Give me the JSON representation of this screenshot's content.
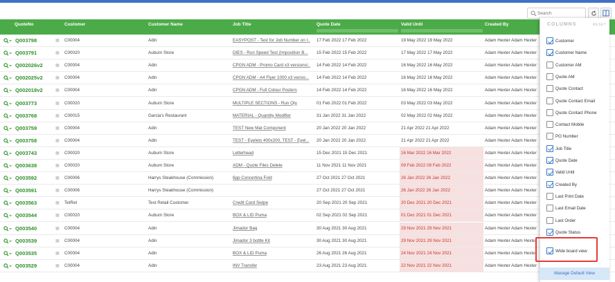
{
  "toolbar": {
    "search_placeholder": "Search"
  },
  "columns": [
    "QuoteNo",
    "Customer",
    "Customer Name",
    "Job Title",
    "Quote Date",
    "Valid Until",
    "Created By"
  ],
  "rows": [
    {
      "quote": "Q003798",
      "customer": "C00004",
      "customer_name": "Adin",
      "job_title": "EASYPOST - Test for Job Number on I...",
      "quote_date": "17 Feb 2022 17 Feb 2022",
      "valid_until": "19 May 2022 19 May 2022",
      "created_by": "Adam Hexter Adam Hexter",
      "expired": false
    },
    {
      "quote": "Q003791",
      "customer": "C00020",
      "customer_name": "Auburn Store",
      "job_title": "DIES - Run Speed Test (Imposition B...",
      "quote_date": "15 Feb 2022 15 Feb 2022",
      "valid_until": "17 May 2022 17 May 2022",
      "created_by": "Adam Hexter Adam Hexter",
      "expired": false
    },
    {
      "quote": "Q002026v2",
      "customer": "C00004",
      "customer_name": "Adin",
      "job_title": "CPGN ADM - Promo Card x3 versions/...",
      "quote_date": "14 Feb 2022 14 Feb 2022",
      "valid_until": "16 May 2022 16 May 2022",
      "created_by": "Adam Hexter Adam Hexter",
      "expired": false
    },
    {
      "quote": "Q002025v2",
      "customer": "C00004",
      "customer_name": "Adin",
      "job_title": "CPGN ADM - A4 Flyer 1000 x3 versio...",
      "quote_date": "14 Feb 2022 14 Feb 2022",
      "valid_until": "16 May 2022 16 May 2022",
      "created_by": "Adam Hexter Adam Hexter",
      "expired": false
    },
    {
      "quote": "Q002018v2",
      "customer": "C00004",
      "customer_name": "Adin",
      "job_title": "CPGN ADM - Full Colour Posters",
      "quote_date": "14 Feb 2022 14 Feb 2022",
      "valid_until": "16 May 2022 16 May 2022",
      "created_by": "Adam Hexter Adam Hexter",
      "expired": false
    },
    {
      "quote": "Q003773",
      "customer": "C00020",
      "customer_name": "Auburn Store",
      "job_title": "MULTIPLE SECTIONS - Run Qty",
      "quote_date": "01 Feb 2022 01 Feb 2022",
      "valid_until": "03 May 2022 03 May 2022",
      "created_by": "Adam Hexter Adam Hexter",
      "expired": false
    },
    {
      "quote": "Q003768",
      "customer": "C00015",
      "customer_name": "Garcia's Restaurant",
      "job_title": "MATERIAL - Quantity Modifier",
      "quote_date": "31 Jan 2022 31 Jan 2022",
      "valid_until": "02 May 2022 02 May 2022",
      "created_by": "Adam Hexter Adam Hexter",
      "expired": false
    },
    {
      "quote": "Q003759",
      "customer": "C00004",
      "customer_name": "Adin",
      "job_title": "TEST New Mat Component",
      "quote_date": "20 Jan 2022 20 Jan 2022",
      "valid_until": "21 Apr 2022 21 Apr 2022",
      "created_by": "Adam Hexter Adam Hexter",
      "expired": false
    },
    {
      "quote": "Q003758",
      "customer": "C00004",
      "customer_name": "Adin",
      "job_title": "TEST - Eyelets 400x200, TEST - Eyel...",
      "quote_date": "20 Jan 2022 20 Jan 2022",
      "valid_until": "21 Apr 2022 21 Apr 2022",
      "created_by": "Adam Hexter Adam Hexter",
      "expired": false
    },
    {
      "quote": "Q003743",
      "customer": "C00020",
      "customer_name": "Auburn Store",
      "job_title": "Letterhead",
      "quote_date": "15 Dec 2021 15 Dec 2021",
      "valid_until": "16 Mar 2022 16 Mar 2022",
      "created_by": "Adam Hexter Adam Hexter",
      "expired": true
    },
    {
      "quote": "Q003638",
      "customer": "C00020",
      "customer_name": "Auburn Store",
      "job_title": "ADM - Quote Files Delete",
      "quote_date": "11 Nov 2021 11 Nov 2021",
      "valid_until": "09 Feb 2022 09 Feb 2022",
      "created_by": "Adam Hexter Adam Hexter",
      "expired": true
    },
    {
      "quote": "Q003592",
      "customer": "C00006",
      "customer_name": "Harrys Steakhouse (Commission)",
      "job_title": "6pp Concertina Fold",
      "quote_date": "27 Oct 2021 27 Oct 2021",
      "valid_until": "26 Jan 2022 26 Jan 2022",
      "created_by": "Adam Hexter Adam Hexter",
      "expired": true
    },
    {
      "quote": "Q003591",
      "customer": "C00006",
      "customer_name": "Harrys Steakhouse (Commission)",
      "job_title": "",
      "quote_date": "27 Oct 2021 27 Oct 2021",
      "valid_until": "26 Jan 2022 26 Jan 2022",
      "created_by": "Adam Hexter Adam Hexter",
      "expired": true
    },
    {
      "quote": "Q003563",
      "customer": "TetRet",
      "customer_name": "Test Retail Customer",
      "job_title": "Credit Card Swipe",
      "quote_date": "20 Sep 2021 20 Sep 2021",
      "valid_until": "20 Dec 2021 20 Dec 2021",
      "created_by": "Adam Hexter Adam Hexter",
      "expired": true
    },
    {
      "quote": "Q003544",
      "customer": "C00020",
      "customer_name": "Auburn Store",
      "job_title": "BOX & LID Puma",
      "quote_date": "02 Sep 2021 02 Sep 2021",
      "valid_until": "01 Dec 2021 01 Dec 2021",
      "created_by": "Adam Hexter Adam Hexter",
      "expired": true
    },
    {
      "quote": "Q003540",
      "customer": "C00004",
      "customer_name": "Adin",
      "job_title": "Jimador Bag",
      "quote_date": "30 Aug 2021 30 Aug 2021",
      "valid_until": "29 Nov 2021 29 Nov 2021",
      "created_by": "Adam Hexter Adam Hexter",
      "expired": true
    },
    {
      "quote": "Q003539",
      "customer": "C00004",
      "customer_name": "Adin",
      "job_title": "Jimador 3 bottle Kit",
      "quote_date": "30 Aug 2021 30 Aug 2021",
      "valid_until": "29 Nov 2021 29 Nov 2021",
      "created_by": "Adam Hexter Adam Hexter",
      "expired": true
    },
    {
      "quote": "Q003535",
      "customer": "C00004",
      "customer_name": "Adin",
      "job_title": "BOX & LID Puma",
      "quote_date": "26 Aug 2021 26 Aug 2021",
      "valid_until": "24 Nov 2021 24 Nov 2021",
      "created_by": "Adam Hexter Adam Hexter",
      "expired": true
    },
    {
      "quote": "Q003529",
      "customer": "C00004",
      "customer_name": "Adin",
      "job_title": "INV Transfer",
      "quote_date": "23 Aug 2021 23 Aug 2021",
      "valid_until": "22 Nov 2021 22 Nov 2021",
      "created_by": "Adam Hexter Adam Hexter",
      "expired": true
    }
  ],
  "panel": {
    "title": "COLUMNS",
    "reset": "RESET",
    "items": [
      {
        "label": "Customer",
        "checked": true
      },
      {
        "label": "Customer Name",
        "checked": true
      },
      {
        "label": "Customer AM",
        "checked": false
      },
      {
        "label": "Quote AM",
        "checked": false
      },
      {
        "label": "Quote Contact",
        "checked": false
      },
      {
        "label": "Quote Contact Email",
        "checked": false
      },
      {
        "label": "Quote Contact Phone",
        "checked": false
      },
      {
        "label": "Contact Mobile",
        "checked": false
      },
      {
        "label": "PO Number",
        "checked": false
      },
      {
        "label": "Job Title",
        "checked": true
      },
      {
        "label": "Quote Date",
        "checked": true
      },
      {
        "label": "Valid Until",
        "checked": true
      },
      {
        "label": "Created By",
        "checked": true
      },
      {
        "label": "Last Print Date",
        "checked": false
      },
      {
        "label": "Last Email Date",
        "checked": false
      },
      {
        "label": "Last Order",
        "checked": false
      },
      {
        "label": "Quote Status",
        "checked": true
      }
    ],
    "wide_board": {
      "label": "Wide board view",
      "checked": true
    },
    "manage_default": "Manage Default View"
  },
  "colors": {
    "header_green": "#4bab48",
    "quote_green": "#2f8f2a",
    "expired_bg": "#f7e0e0",
    "expired_text": "#c0392b",
    "accent_blue": "#3a73c6",
    "highlight_red": "#e53935"
  }
}
